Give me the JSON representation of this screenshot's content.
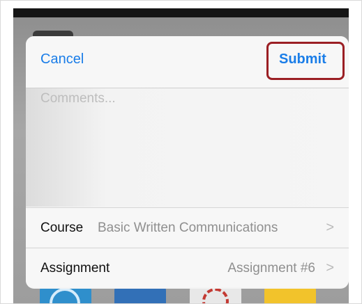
{
  "sheet": {
    "cancel_label": "Cancel",
    "submit_label": "Submit",
    "comments_placeholder": "Comments...",
    "course": {
      "label": "Course",
      "value": "Basic Written Communications",
      "chevron": ">"
    },
    "assignment": {
      "label": "Assignment",
      "value": "Assignment #6",
      "chevron": ">"
    }
  },
  "colors": {
    "accent": "#1a7de8",
    "highlight": "#9b1f24"
  }
}
